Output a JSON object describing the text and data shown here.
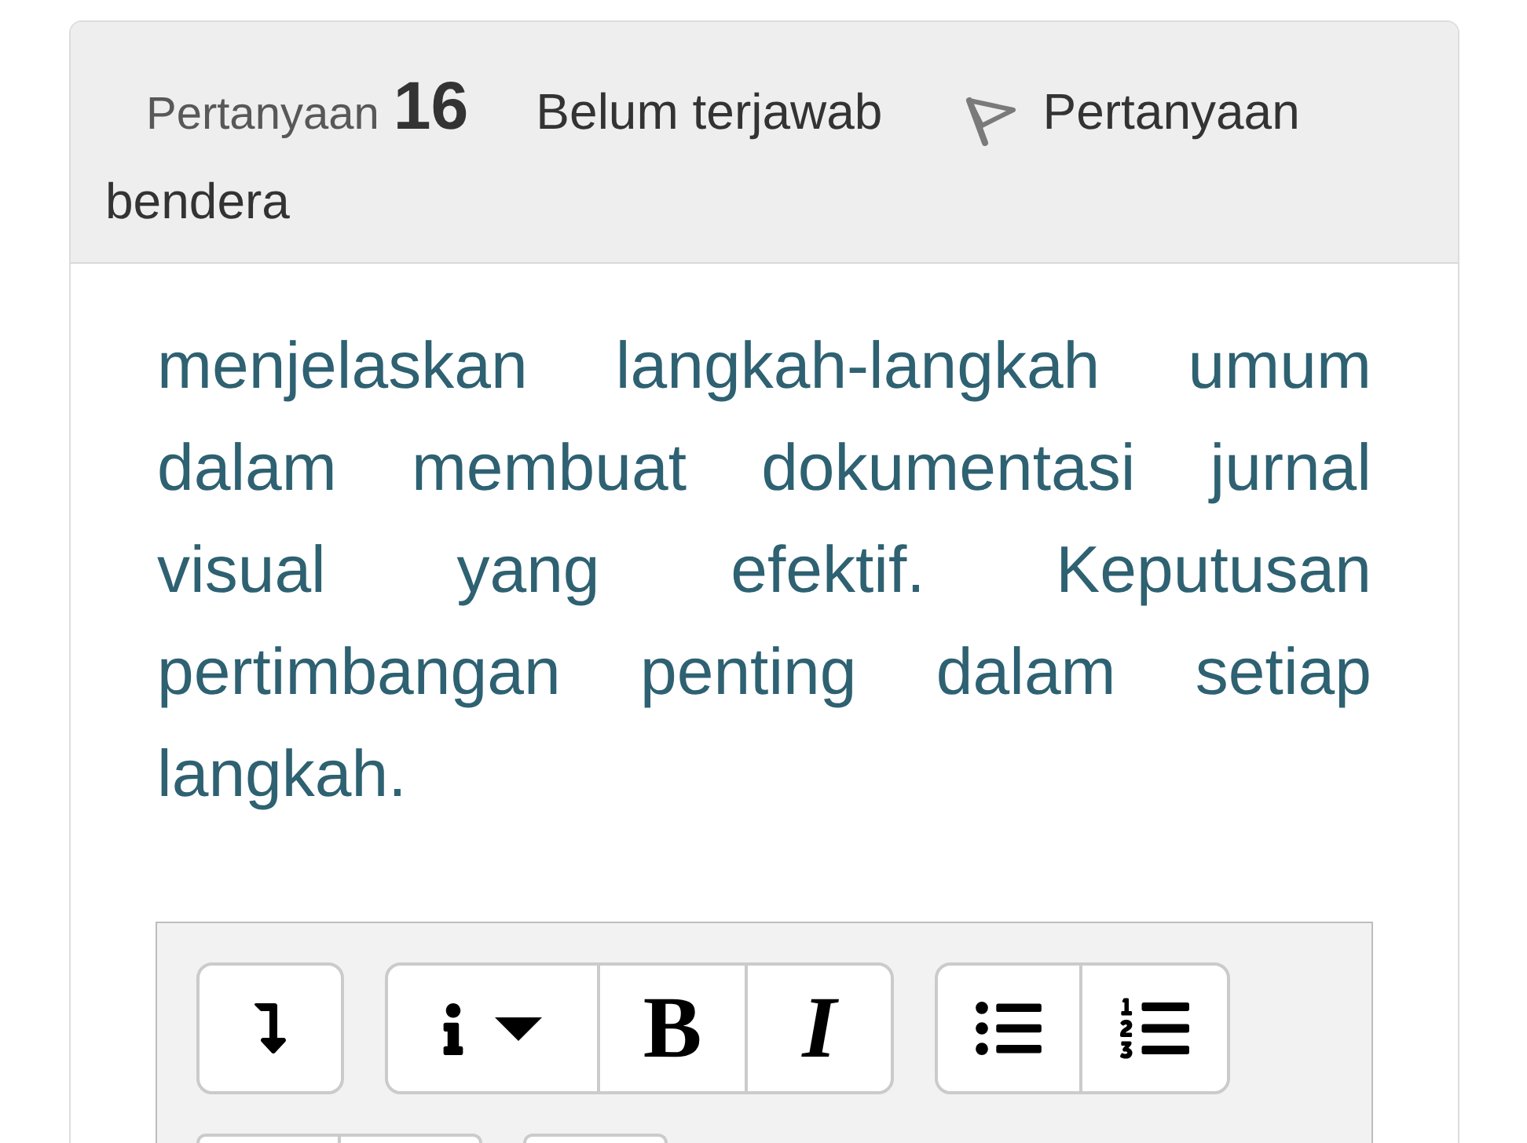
{
  "question": {
    "label": "Pertanyaan",
    "number": "16",
    "status": "Belum terjawab",
    "flag": {
      "label": "Pertanyaan bendera",
      "flagged": false
    }
  },
  "question_text": "menjelaskan langkah-langkah umum dalam membuat dokumentasi jurnal visual yang efektif. Keputusan pertimbangan penting dalam setiap langkah.",
  "editor": {
    "toolbar_rows": [
      {
        "groups": [
          {
            "buttons": [
              {
                "kind": "toggle"
              }
            ]
          },
          {
            "buttons": [
              {
                "kind": "style-dropdown"
              },
              {
                "kind": "bold",
                "label": "B"
              },
              {
                "kind": "italic",
                "label": "I"
              }
            ]
          },
          {
            "buttons": [
              {
                "kind": "bullet-list"
              },
              {
                "kind": "numbered-list"
              }
            ]
          }
        ]
      },
      {
        "groups": [
          {
            "buttons": [
              {
                "kind": "partial"
              },
              {
                "kind": "partial"
              }
            ]
          },
          {
            "buttons": [
              {
                "kind": "partial"
              }
            ]
          }
        ]
      }
    ]
  }
}
